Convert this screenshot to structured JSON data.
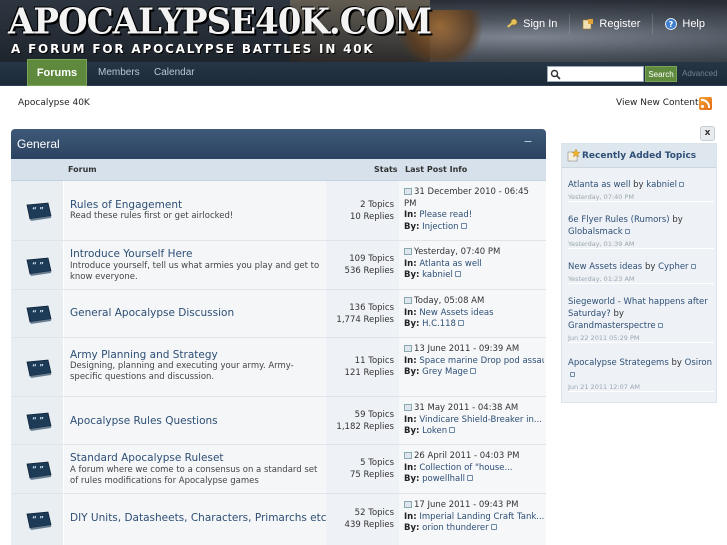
{
  "header": {
    "logo_title": "APOCALYPSE40K.COM",
    "logo_subtitle": "A FORUM FOR APOCALYPSE BATTLES IN 40K",
    "links": [
      {
        "label": "Sign In",
        "icon": "key-icon"
      },
      {
        "label": "Register",
        "icon": "register-icon"
      },
      {
        "label": "Help",
        "icon": "help-icon"
      }
    ]
  },
  "nav": {
    "tabs": [
      "Forums",
      "Members",
      "Calendar"
    ],
    "search_placeholder": "",
    "search_button": "Search",
    "advanced": "Advanced"
  },
  "breadcrumb": {
    "home": "Apocalypse 40K",
    "view_new_content": "View New Content"
  },
  "category": {
    "title": "General",
    "collapse": "−",
    "columns": {
      "forum": "Forum",
      "stats": "Stats",
      "last_post": "Last Post Info"
    }
  },
  "forums": [
    {
      "title": "Rules of Engagement",
      "desc": "Read these rules first or get airlocked!",
      "topics": "2 Topics",
      "replies": "10 Replies",
      "lp_date": "31 December 2010 - 06:45 PM",
      "lp_in_label": "In:",
      "lp_in": "Please read!",
      "lp_by_label": "By:",
      "lp_by": "Injection"
    },
    {
      "title": "Introduce Yourself Here",
      "desc": "Introduce yourself, tell us what armies you play and get to know everyone.",
      "topics": "109 Topics",
      "replies": "536 Replies",
      "lp_date": "Yesterday, 07:40 PM",
      "lp_in_label": "In:",
      "lp_in": "Atlanta as well",
      "lp_by_label": "By:",
      "lp_by": "kabniel"
    },
    {
      "title": "General Apocalypse Discussion",
      "desc": "",
      "topics": "136 Topics",
      "replies": "1,774 Replies",
      "lp_date": "Today, 05:08 AM",
      "lp_in_label": "In:",
      "lp_in": "New Assets ideas",
      "lp_by_label": "By:",
      "lp_by": "H.C.118"
    },
    {
      "title": "Army Planning and Strategy",
      "desc": "Designing, planning and executing your army. Army-specific questions and discussion.",
      "topics": "11 Topics",
      "replies": "121 Replies",
      "lp_date": "13 June 2011 - 09:39 AM",
      "lp_in_label": "In:",
      "lp_in": "Space marine Drop pod assau...",
      "lp_by_label": "By:",
      "lp_by": "Grey Mage"
    },
    {
      "title": "Apocalypse Rules Questions",
      "desc": "",
      "topics": "59 Topics",
      "replies": "1,182 Replies",
      "lp_date": "31 May 2011 - 04:38 AM",
      "lp_in_label": "In:",
      "lp_in": "Vindicare Shield-Breaker in...",
      "lp_by_label": "By:",
      "lp_by": "Loken"
    },
    {
      "title": "Standard Apocalypse Ruleset",
      "desc": "A forum where we come to a consensus on a standard set of rules modifications for Apocalypse games",
      "topics": "5 Topics",
      "replies": "75 Replies",
      "lp_date": "26 April 2011 - 04:03 PM",
      "lp_in_label": "In:",
      "lp_in": "Collection of \"house...",
      "lp_by_label": "By:",
      "lp_by": "powellhall"
    },
    {
      "title": "DIY Units, Datasheets, Characters, Primarchs etc.",
      "desc": "",
      "topics": "52 Topics",
      "replies": "439 Replies",
      "lp_date": "17 June 2011 - 09:43 PM",
      "lp_in_label": "In:",
      "lp_in": "Imperial Landing Craft Tank...",
      "lp_by_label": "By:",
      "lp_by": "orion thunderer"
    }
  ],
  "sidebar": {
    "close": "x",
    "title": "Recently Added Topics",
    "items": [
      {
        "topic": "Atlanta as well",
        "by": "by",
        "author": "kabniel",
        "time": "Yesterday, 07:40 PM"
      },
      {
        "topic": "6e Flyer Rules (Rumors)",
        "by": "by",
        "author": "Globalsmack",
        "time": "Yesterday, 01:39 AM"
      },
      {
        "topic": "New Assets ideas",
        "by": "by",
        "author": "Cypher",
        "time": "Yesterday, 01:23 AM"
      },
      {
        "topic": "Siegeworld - What happens after Saturday?",
        "by": "by",
        "author": "Grandmasterspectre",
        "time": "Jun 22 2011 05:29 PM"
      },
      {
        "topic": "Apocalypse Strategems",
        "by": "by",
        "author": "Osiron",
        "time": "Jun 21 2011 12:07 AM"
      }
    ]
  }
}
